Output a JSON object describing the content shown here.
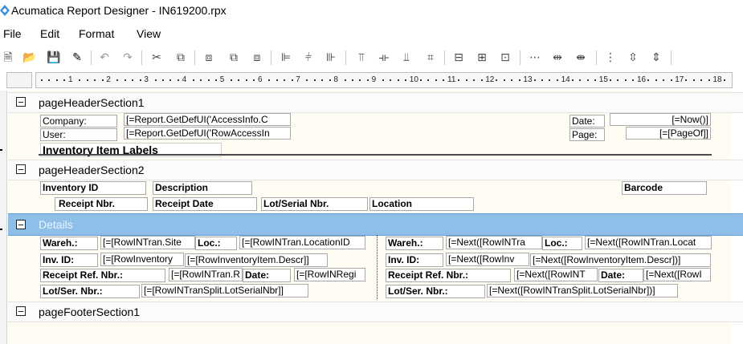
{
  "window": {
    "title": "Acumatica Report Designer - IN619200.rpx"
  },
  "menu": [
    "File",
    "Edit",
    "Format",
    "View"
  ],
  "ruler": [
    "1",
    "2",
    "3",
    "4",
    "5",
    "6",
    "7",
    "8",
    "9",
    "10",
    "11",
    "12",
    "13",
    "14",
    "15",
    "16",
    "17",
    "18"
  ],
  "toolbar_icons": [
    "new-icon",
    "open-icon",
    "save-icon",
    "properties-icon",
    "undo-icon",
    "redo-icon",
    "cut-icon",
    "copy-icon",
    "paste-icon",
    "bring-forward-icon",
    "send-backward-icon",
    "align-left-icon",
    "align-center-icon",
    "align-right-icon",
    "align-top-icon",
    "align-middle-icon",
    "align-bottom-icon",
    "align-grid-icon",
    "same-width-icon",
    "same-height-icon",
    "same-size-icon",
    "hspace-equal-icon",
    "hspace-increase-icon",
    "hspace-decrease-icon",
    "vspace-equal-icon",
    "vspace-increase-icon",
    "vspace-decrease-icon"
  ],
  "sections": {
    "page_header_1": "pageHeaderSection1",
    "page_header_2": "pageHeaderSection2",
    "details": "Details",
    "page_footer_1": "pageFooterSection1"
  },
  "header1": {
    "company_label": "Company:",
    "company_value": "[=Report.GetDefUI('AccessInfo.C",
    "user_label": "User:",
    "user_value": "[=Report.GetDefUI('RowAccessIn",
    "date_label": "Date:",
    "date_value": "[=Now()]",
    "page_label": "Page:",
    "page_value": "[=[PageOf]]",
    "report_title": "Inventory Item Labels"
  },
  "header2": {
    "inventory_id": "Inventory ID",
    "description": "Description",
    "barcode": "Barcode",
    "receipt_nbr": "Receipt Nbr.",
    "receipt_date": "Receipt Date",
    "lot_serial": "Lot/Serial Nbr.",
    "location": "Location"
  },
  "details_left": {
    "wareh_label": "Wareh.:",
    "wareh_value": "[=[RowINTran.Site",
    "loc_label": "Loc.:",
    "loc_value": "[=[RowINTran.LocationID",
    "invid_label": "Inv. ID:",
    "invid_value": "[=[RowInventory",
    "descr_value": "[=[RowInventoryItem.Descr]]",
    "receipt_label": "Receipt Ref. Nbr.:",
    "receipt_value": "[=[RowINTran.R",
    "date_label": "Date:",
    "date_value": "[=[RowINRegi",
    "lot_label": "Lot/Ser. Nbr.:",
    "lot_value": "[=[RowINTranSplit.LotSerialNbr]]"
  },
  "details_right": {
    "wareh_label": "Wareh.:",
    "wareh_value": "[=Next([RowINTra",
    "loc_label": "Loc.:",
    "loc_value": "[=Next([RowINTran.Locat",
    "invid_label": "Inv. ID:",
    "invid_value": "[=Next([RowInv",
    "descr_value": "[=Next([RowInventoryItem.Descr])]",
    "receipt_label": "Receipt Ref. Nbr.:",
    "receipt_value": "[=Next([RowINT",
    "date_label": "Date:",
    "date_value": "[=Next([RowI",
    "lot_label": "Lot/Ser. Nbr.:",
    "lot_value": "[=Next([RowINTranSplit.LotSerialNbr])]"
  }
}
